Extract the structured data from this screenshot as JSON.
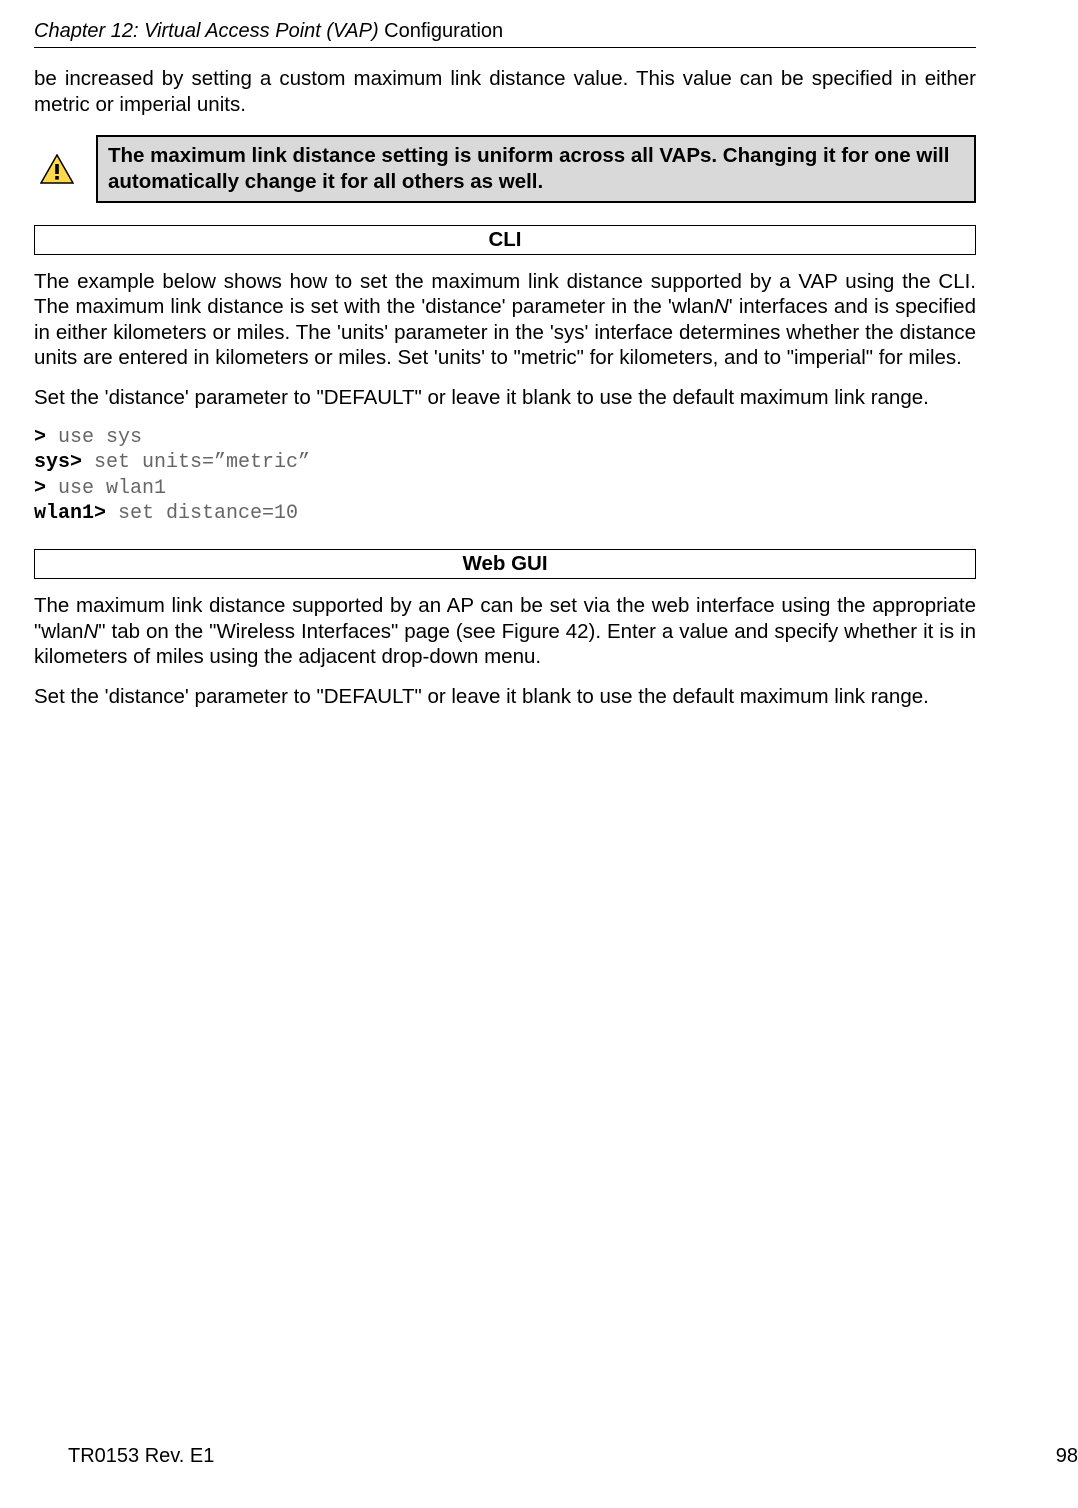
{
  "header": {
    "chapter_prefix": "Chapter 12: Virtual Access Point (VAP) ",
    "chapter_suffix": "Configuration"
  },
  "intro_para": "be increased by setting a custom maximum link distance value. This value can be specified in either metric or imperial units.",
  "callout": "The maximum link distance setting is uniform across all VAPs. Changing it for one will automatically change it for all others as well.",
  "cli": {
    "heading": "CLI",
    "para1_a": "The example below shows how to set the maximum link distance supported by a VAP using the CLI. The maximum link distance is set with the 'distance' parameter in the 'wlan",
    "para1_n": "N",
    "para1_b": "' interfaces and is specified in either kilometers or miles. The 'units' parameter in the 'sys' interface determines whether the distance units are entered in kilometers or miles. Set 'units' to \"metric\" for kilometers, and to \"imperial\" for miles.",
    "para2": "Set the 'distance' parameter to \"DEFAULT\" or leave it blank to use the default maximum link range.",
    "lines": {
      "l1_prompt": "> ",
      "l1_cmd": "use sys",
      "l2_prompt": "sys> ",
      "l2_cmd": "set units=”metric”",
      "l3_prompt": "> ",
      "l3_cmd": "use wlan1",
      "l4_prompt": "wlan1> ",
      "l4_cmd": "set distance=10"
    }
  },
  "webgui": {
    "heading": "Web GUI",
    "para1_a": "The maximum link distance supported by an AP can be set via the web interface using the appropriate \"wlan",
    "para1_n": "N",
    "para1_b": "\" tab on the \"Wireless Interfaces\" page (see Figure 42). Enter a value and specify whether it is in kilometers of miles using the adjacent drop-down menu.",
    "para2": "Set the 'distance' parameter to \"DEFAULT\" or leave it blank to use the default maximum link range."
  },
  "footer": {
    "doc_rev": "TR0153 Rev. E1",
    "page_num": "98"
  }
}
